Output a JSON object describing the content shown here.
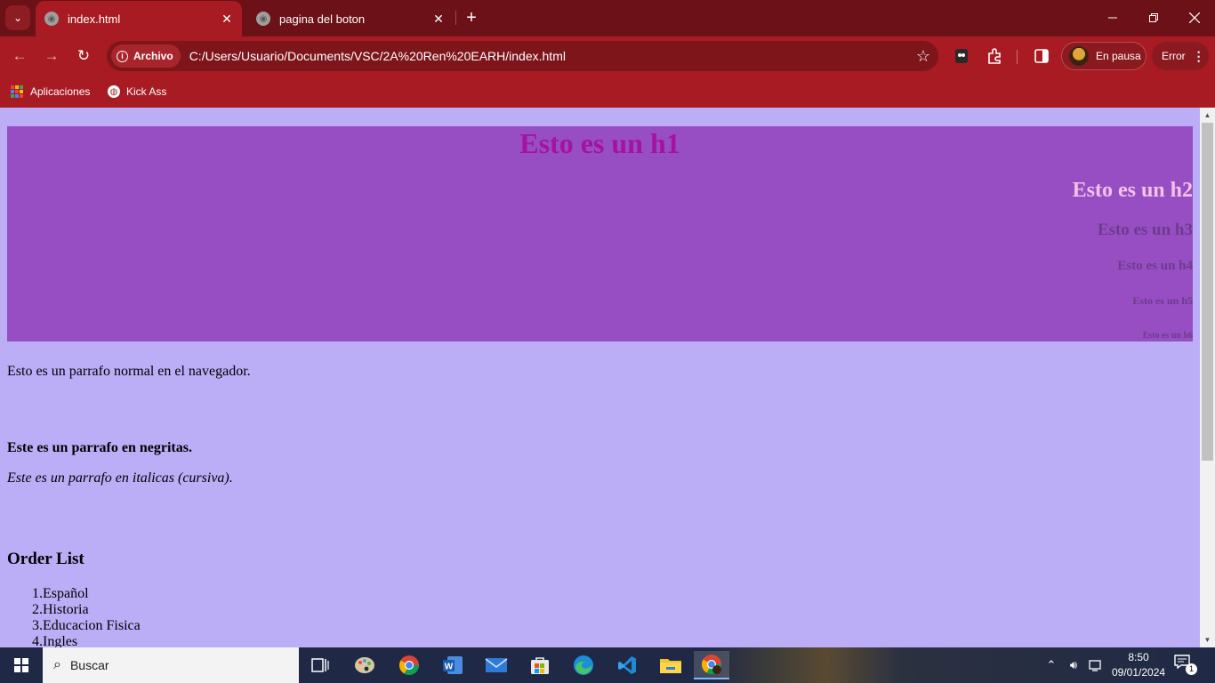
{
  "browser": {
    "tabs": [
      {
        "title": "index.html",
        "active": true
      },
      {
        "title": "pagina del boton",
        "active": false
      }
    ],
    "address": {
      "chip_label": "Archivo",
      "url": "C:/Users/Usuario/Documents/VSC/2A%20Ren%20EARH/index.html"
    },
    "profile_label": "En pausa",
    "error_label": "Error",
    "bookmarks": [
      {
        "label": "Aplicaciones",
        "icon": "apps-grid-icon"
      },
      {
        "label": "Kick Ass",
        "icon": "globe-icon"
      }
    ],
    "theme_color": "#a81b22"
  },
  "page": {
    "background": "#bcadf7",
    "heading_background": "#974ec3",
    "h1": "Esto es un h1",
    "h2": "Esto es un h2",
    "h3": "Esto es un h3",
    "h4": "Esto es un h4",
    "h5": "Esto es un h5",
    "h6": "Esto es un h6",
    "p_normal": "Esto es un parrafo normal en el navegador.",
    "p_bold": "Este es un parrafo en negritas.",
    "p_italic": "Este es un parrafo en italicas (cursiva).",
    "order_title": "Order List",
    "order_items": [
      {
        "num": "1.",
        "text": "Español"
      },
      {
        "num": "2.",
        "text": "Historia"
      },
      {
        "num": "3.",
        "text": "Educacion Fisica"
      },
      {
        "num": "4.",
        "text": "Ingles"
      }
    ]
  },
  "taskbar": {
    "search_placeholder": "Buscar",
    "time": "8:50",
    "date": "09/01/2024",
    "notification_count": "1"
  }
}
